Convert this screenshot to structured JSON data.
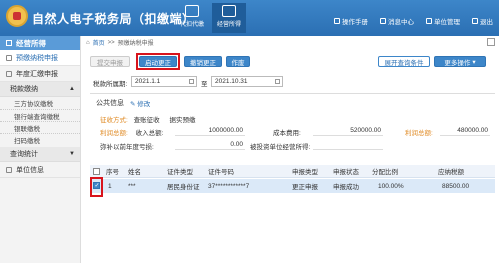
{
  "header": {
    "title": "自然人电子税务局（扣缴端）",
    "nav": [
      {
        "label": "代扣代缴",
        "icon": "table-icon"
      },
      {
        "label": "经营所得",
        "icon": "briefcase-icon"
      }
    ],
    "links": [
      "操作手册",
      "消息中心",
      "单位管理",
      "退出"
    ]
  },
  "sidebar": {
    "heading": "经营所得",
    "items": [
      {
        "label": "预缴纳税申报"
      },
      {
        "label": "年度汇缴申报"
      }
    ],
    "groups": [
      {
        "label": "税款缴纳",
        "children": [
          "三方协议缴税",
          "银行端查询缴税",
          "银联缴税",
          "扫码缴税"
        ]
      },
      {
        "label": "查询统计"
      },
      {
        "label": "单位信息"
      }
    ]
  },
  "breadcrumb": {
    "home": "首页",
    "sep": ">>",
    "current": "预缴纳税申报"
  },
  "toolbar": {
    "submit": "提交申报",
    "start_correct": "启动更正",
    "cancel_correct": "撤销更正",
    "void": "作废",
    "expand_query": "展开查询条件",
    "more": "更多操作"
  },
  "period": {
    "label": "税款所属期:",
    "from": "2021.1.1",
    "to_label": "至",
    "to": "2021.10.31"
  },
  "public_info": {
    "title": "公共信息",
    "edit": "修改",
    "levy_label": "征收方式:",
    "levy_value": "查账征收",
    "levy_note": "据实预缴",
    "rows": [
      [
        {
          "label": "利润总额:",
          "sub": "收入总额:",
          "value": "1000000.00"
        },
        {
          "label": "成本费用:",
          "value": "520000.00"
        },
        {
          "label": "利润总额:",
          "value": "480000.00"
        }
      ],
      [
        {
          "label": "弥补以前年度亏损:",
          "value": "0.00"
        },
        {
          "label": "被投资单位经营所得:",
          "value": ""
        }
      ]
    ]
  },
  "table": {
    "headers": [
      "序号",
      "姓名",
      "证件类型",
      "证件号码",
      "申报类型",
      "申报状态",
      "分配比例",
      "应纳税额"
    ],
    "rows": [
      {
        "checked": true,
        "cells": [
          "1",
          "***",
          "居民身份证",
          "37************7",
          "更正申报",
          "申报成功",
          "100.00%",
          "88500.00"
        ]
      }
    ]
  }
}
